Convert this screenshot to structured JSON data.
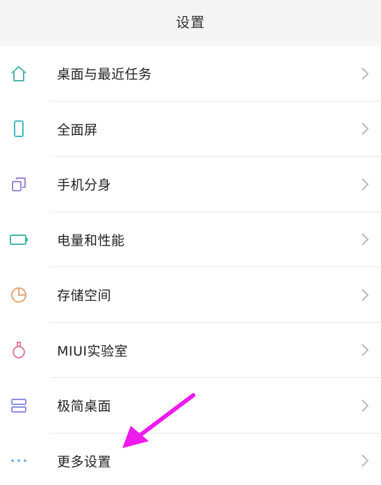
{
  "header": {
    "title": "设置"
  },
  "items": [
    {
      "label": "桌面与最近任务",
      "icon": "home-icon",
      "color": "#4fb6ac"
    },
    {
      "label": "全面屏",
      "icon": "phone-icon",
      "color": "#3fb8c4"
    },
    {
      "label": "手机分身",
      "icon": "clone-icon",
      "color": "#9b86d9"
    },
    {
      "label": "电量和性能",
      "icon": "battery-icon",
      "color": "#3fb8a6"
    },
    {
      "label": "存储空间",
      "icon": "storage-pie-icon",
      "color": "#e8a070"
    },
    {
      "label": "MIUI实验室",
      "icon": "lab-flask-icon",
      "color": "#e07a9a"
    },
    {
      "label": "极简桌面",
      "icon": "minimal-desktop-icon",
      "color": "#8a8ee0"
    },
    {
      "label": "更多设置",
      "icon": "more-dots-icon",
      "color": "#5aa8e0"
    }
  ],
  "annotation": {
    "arrow_color": "#ee1aee"
  }
}
